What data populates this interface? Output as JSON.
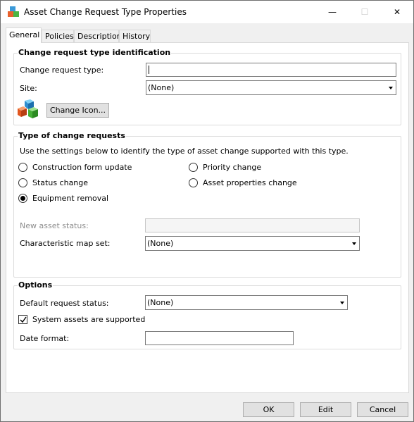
{
  "window": {
    "title": "Asset Change Request Type Properties",
    "controls": {
      "minimize": "—",
      "maximize": "☐",
      "close": "✕"
    }
  },
  "tabs": [
    {
      "label": "General",
      "active": true
    },
    {
      "label": "Policies",
      "active": false
    },
    {
      "label": "Description",
      "active": false
    },
    {
      "label": "History",
      "active": false
    }
  ],
  "identification": {
    "title": "Change request type identification",
    "change_request_type_label": "Change request type:",
    "change_request_type_value": "",
    "site_label": "Site:",
    "site_value": "(None)",
    "icon": "stacked-cubes-icon",
    "change_icon_button": "Change Icon..."
  },
  "type_of_change": {
    "title": "Type of change requests",
    "description": "Use the settings below to identify the type of asset change supported with this type.",
    "options": [
      {
        "label": "Construction form update",
        "checked": false
      },
      {
        "label": "Priority change",
        "checked": false
      },
      {
        "label": "Status change",
        "checked": false
      },
      {
        "label": "Asset properties change",
        "checked": false
      },
      {
        "label": "Equipment removal",
        "checked": true
      }
    ],
    "new_asset_status_label": "New asset status:",
    "new_asset_status_value": "",
    "characteristic_map_set_label": "Characteristic map set:",
    "characteristic_map_set_value": "(None)"
  },
  "options": {
    "title": "Options",
    "default_request_status_label": "Default request status:",
    "default_request_status_value": "(None)",
    "system_assets_label": "System assets are supported",
    "system_assets_checked": true,
    "date_format_label": "Date format:",
    "date_format_value": ""
  },
  "buttons": {
    "ok": "OK",
    "edit": "Edit",
    "cancel": "Cancel"
  }
}
